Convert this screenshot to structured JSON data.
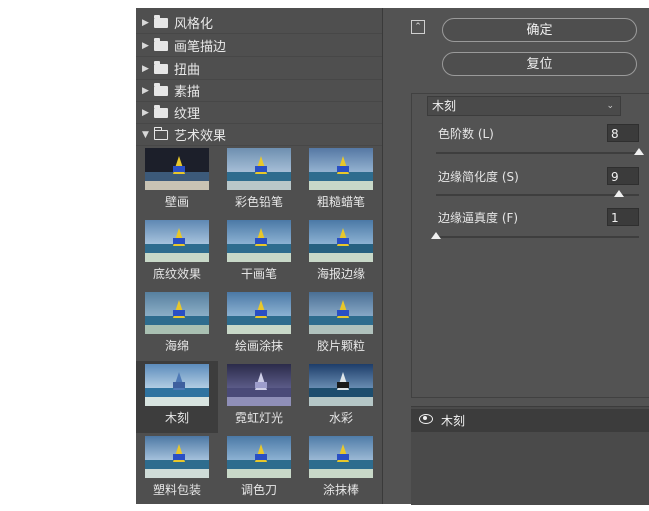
{
  "categories": [
    {
      "label": "风格化",
      "open": false
    },
    {
      "label": "画笔描边",
      "open": false
    },
    {
      "label": "扭曲",
      "open": false
    },
    {
      "label": "素描",
      "open": false
    },
    {
      "label": "纹理",
      "open": false
    },
    {
      "label": "艺术效果",
      "open": true
    }
  ],
  "thumbnails": [
    {
      "label": "壁画"
    },
    {
      "label": "彩色铅笔"
    },
    {
      "label": "粗糙蜡笔"
    },
    {
      "label": "底纹效果"
    },
    {
      "label": "干画笔"
    },
    {
      "label": "海报边缘"
    },
    {
      "label": "海绵"
    },
    {
      "label": "绘画涂抹"
    },
    {
      "label": "胶片颗粒"
    },
    {
      "label": "木刻"
    },
    {
      "label": "霓虹灯光"
    },
    {
      "label": "水彩"
    },
    {
      "label": "塑料包装"
    },
    {
      "label": "调色刀"
    },
    {
      "label": "涂抹棒"
    }
  ],
  "buttons": {
    "ok": "确定",
    "reset": "复位"
  },
  "filter_select": {
    "value": "木刻"
  },
  "params": [
    {
      "label": "色阶数 (L)",
      "value": "8",
      "level": 1.0
    },
    {
      "label": "边缘简化度 (S)",
      "value": "9",
      "level": 0.9
    },
    {
      "label": "边缘逼真度 (F)",
      "value": "1",
      "level": 0.0
    }
  ],
  "layers": {
    "name": "木刻"
  },
  "icons": {
    "collapse": "collapse-icon",
    "eye": "eye-icon",
    "folder": "folder-icon",
    "chevron": "chevron-down-icon"
  }
}
